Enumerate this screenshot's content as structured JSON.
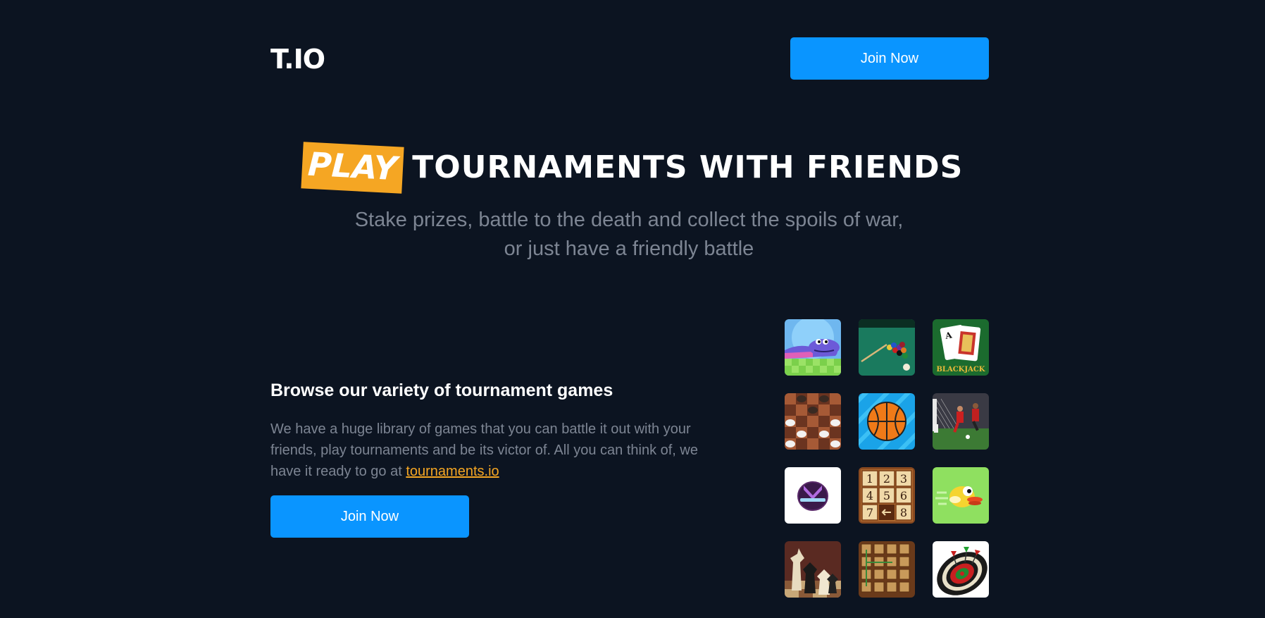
{
  "header": {
    "logo": "T.IO",
    "join_label": "Join Now"
  },
  "hero": {
    "badge": "PLAY",
    "title_rest": "TOURNAMENTS WITH FRIENDS",
    "subtitle_line1": "Stake prizes, battle to the death and collect the spoils of war,",
    "subtitle_line2": "or just have a friendly battle"
  },
  "browse": {
    "title": "Browse our variety of tournament games",
    "text": "We have a huge library of games that you can battle it out with your friends, play tournaments and be its victor of. All you can think of, we have it ready to go at ",
    "link": "tournaments.io",
    "join_label": "Join Now"
  },
  "games": [
    {
      "icon": "snake-game-icon"
    },
    {
      "icon": "pool-game-icon"
    },
    {
      "icon": "blackjack-game-icon",
      "label": "BLACKJACK"
    },
    {
      "icon": "checkers-game-icon"
    },
    {
      "icon": "basketball-game-icon"
    },
    {
      "icon": "soccer-game-icon"
    },
    {
      "icon": "stack-game-icon"
    },
    {
      "icon": "sliding-puzzle-game-icon",
      "numbers": [
        "1",
        "2",
        "3",
        "4",
        "5",
        "6",
        "7",
        "8"
      ]
    },
    {
      "icon": "flappy-bird-game-icon"
    },
    {
      "icon": "chess-game-icon"
    },
    {
      "icon": "word-tiles-game-icon"
    },
    {
      "icon": "darts-game-icon"
    }
  ],
  "colors": {
    "background": "#0c1421",
    "accent_blue": "#0a95ff",
    "accent_orange": "#f5a623",
    "muted_text": "#7d8593"
  }
}
